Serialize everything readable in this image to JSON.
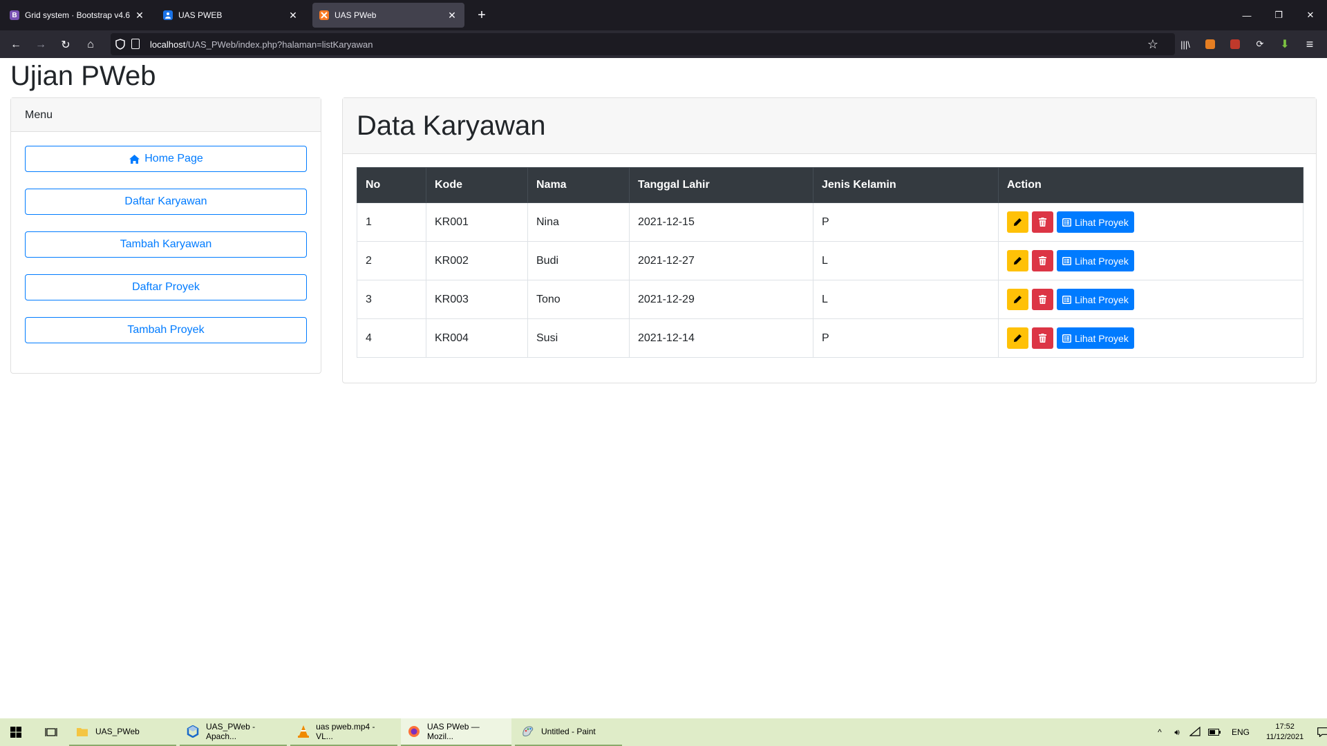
{
  "browser": {
    "tabs": [
      {
        "title": "Grid system · Bootstrap v4.6",
        "favicon": "B"
      },
      {
        "title": "UAS PWEB",
        "favicon": "person"
      },
      {
        "title": "UAS PWeb",
        "favicon": "xampp"
      }
    ],
    "url_host": "localhost",
    "url_path": "/UAS_PWeb/index.php?halaman=listKaryawan"
  },
  "page": {
    "site_title": "Ujian PWeb",
    "menu": {
      "header": "Menu",
      "items": [
        {
          "label": "Home Page",
          "icon": "home-icon"
        },
        {
          "label": "Daftar Karyawan"
        },
        {
          "label": "Tambah Karyawan"
        },
        {
          "label": "Daftar Proyek"
        },
        {
          "label": "Tambah Proyek"
        }
      ]
    },
    "data": {
      "title": "Data Karyawan",
      "columns": [
        "No",
        "Kode",
        "Nama",
        "Tanggal Lahir",
        "Jenis Kelamin",
        "Action"
      ],
      "rows": [
        {
          "no": "1",
          "kode": "KR001",
          "nama": "Nina",
          "tgl": "2021-12-15",
          "jk": "P"
        },
        {
          "no": "2",
          "kode": "KR002",
          "nama": "Budi",
          "tgl": "2021-12-27",
          "jk": "L"
        },
        {
          "no": "3",
          "kode": "KR003",
          "nama": "Tono",
          "tgl": "2021-12-29",
          "jk": "L"
        },
        {
          "no": "4",
          "kode": "KR004",
          "nama": "Susi",
          "tgl": "2021-12-14",
          "jk": "P"
        }
      ],
      "lihat_label": "Lihat Proyek"
    }
  },
  "taskbar": {
    "items": [
      {
        "label": "UAS_PWeb",
        "icon": "folder-icon"
      },
      {
        "label": "UAS_PWeb - Apach...",
        "icon": "netbeans-icon"
      },
      {
        "label": "uas pweb.mp4 - VL...",
        "icon": "vlc-icon"
      },
      {
        "label": "UAS PWeb — Mozil...",
        "icon": "firefox-icon"
      },
      {
        "label": "Untitled - Paint",
        "icon": "paint-icon"
      }
    ],
    "lang": "ENG",
    "time": "17:52",
    "date": "11/12/2021"
  },
  "colors": {
    "primary": "#007bff",
    "warning": "#ffc107",
    "danger": "#dc3545",
    "table_header": "#343a40"
  }
}
